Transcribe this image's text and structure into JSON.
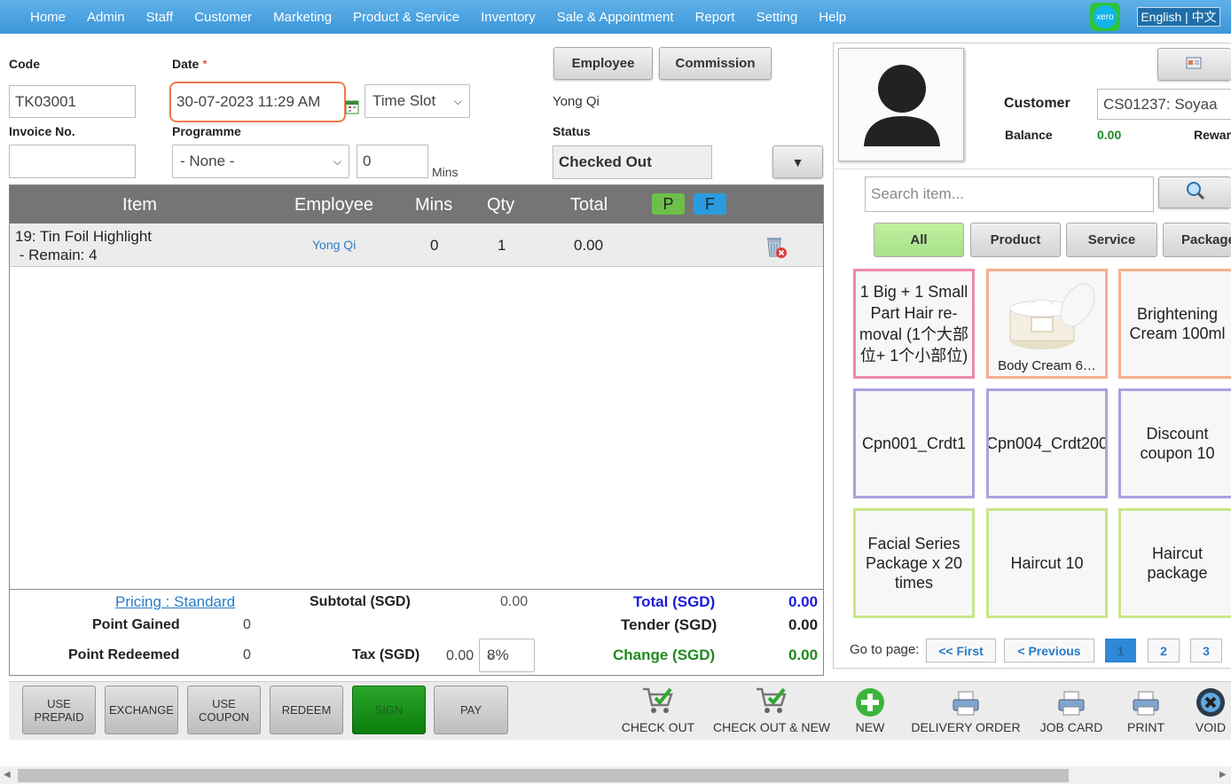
{
  "nav": {
    "items": [
      "Home",
      "Admin",
      "Staff",
      "Customer",
      "Marketing",
      "Product & Service",
      "Inventory",
      "Sale & Appointment",
      "Report",
      "Setting",
      "Help"
    ],
    "xero": "xero",
    "language": "English | 中文"
  },
  "form": {
    "code_label": "Code",
    "code_value": "TK03001",
    "date_label": "Date",
    "date_required": "*",
    "date_value": "30-07-2023 11:29 AM",
    "timeslot_value": "Time Slot",
    "invoice_label": "Invoice No.",
    "invoice_value": "",
    "programme_label": "Programme",
    "programme_value": "- None -",
    "mins_value": "0",
    "mins_label": "Mins",
    "employee_button": "Employee",
    "commission_button": "Commission",
    "employee_name": "Yong Qi",
    "status_label": "Status",
    "status_value": "Checked Out"
  },
  "grid": {
    "headers": {
      "item": "Item",
      "employee": "Employee",
      "mins": "Mins",
      "qty": "Qty",
      "total": "Total",
      "p": "P",
      "f": "F"
    },
    "rows": [
      {
        "item_line1": "19: Tin Foil Highlight",
        "item_line2": " - Remain: 4",
        "employee": "Yong Qi",
        "mins": "0",
        "qty": "1",
        "total": "0.00"
      }
    ],
    "footer": {
      "pricing": "Pricing : Standard",
      "subtotal_label": "Subtotal (SGD)",
      "subtotal_value": "0.00",
      "total_label": "Total (SGD)",
      "total_value": "0.00",
      "point_gained_label": "Point Gained",
      "point_gained_value": "0",
      "tender_label": "Tender (SGD)",
      "tender_value": "0.00",
      "point_redeemed_label": "Point Redeemed",
      "point_redeemed_value": "0",
      "tax_label": "Tax (SGD)",
      "tax_value": "0.00",
      "tax_rate": "8%",
      "change_label": "Change (SGD)",
      "change_value": "0.00"
    }
  },
  "customer": {
    "label": "Customer",
    "value": "CS01237: Soyaa",
    "balance_label": "Balance",
    "balance_value": "0.00",
    "reward_label": "Rewar"
  },
  "search": {
    "placeholder": "Search item..."
  },
  "tabs": [
    "All",
    "Product",
    "Service",
    "Package"
  ],
  "tiles": [
    {
      "label": "1 Big + 1 Small Part Hair re-moval (1个大部位+ 1个小部位)",
      "border": "#f08aa8"
    },
    {
      "label": "Body Cream 6…",
      "border": "#f3b08c"
    },
    {
      "label": "Brightening Cream 100ml",
      "border": "#f3b08c"
    },
    {
      "label": "Cpn001_Crdt1",
      "border": "#a8a3e0"
    },
    {
      "label": "Cpn004_Crdt200",
      "border": "#a8a3e0"
    },
    {
      "label": "Discount coupon 10",
      "border": "#a8a3e0"
    },
    {
      "label": "Facial Series Package x 20 times",
      "border": "#c8e68a"
    },
    {
      "label": "Haircut 10",
      "border": "#c8e68a"
    },
    {
      "label": "Haircut package",
      "border": "#c8e68a"
    }
  ],
  "pagination": {
    "label": "Go to page:",
    "first": "<< First",
    "previous": "< Previous",
    "pages": [
      "1",
      "2",
      "3"
    ]
  },
  "actions": {
    "use_prepaid": "USE PREPAID",
    "exchange": "EXCHANGE",
    "use_coupon": "USE COUPON",
    "redeem": "REDEEM",
    "sign": "SIGN",
    "pay": "PAY",
    "check_out": "CHECK OUT",
    "check_out_new": "CHECK OUT & NEW",
    "new": "NEW",
    "delivery_order": "DELIVERY ORDER",
    "job_card": "JOB CARD",
    "print": "PRINT",
    "void": "VOID"
  }
}
